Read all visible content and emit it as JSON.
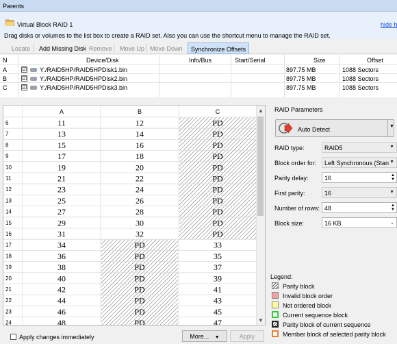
{
  "window": {
    "title": "Parents"
  },
  "panel": {
    "raid_name": "Virtual Block RAID 1",
    "hide_link": "hide hi",
    "instructions": "Drag disks or volumes to the list box to create a RAID set. Also you can use the shortcut menu to manage the RAID set."
  },
  "toolbar": {
    "locate": "Locate",
    "add_missing": "Add Missing Disk",
    "remove": "Remove",
    "move_up": "Move Up",
    "move_down": "Move Down",
    "sync_offsets": "Synchronize Offsets"
  },
  "disk_table": {
    "headers": {
      "n": "N",
      "device": "Device/Disk",
      "info": "Info/Bus",
      "start": "Start/Serial",
      "size": "Size",
      "offset": "Offset"
    },
    "rows": [
      {
        "n": "A",
        "checked": "☑",
        "device": "Y:/RAID5HP/RAID5HPDisk1.bin",
        "size": "897.75 MB",
        "offset": "1088 Sectors"
      },
      {
        "n": "B",
        "checked": "☑",
        "device": "Y:/RAID5HP/RAID5HPDisk2.bin",
        "size": "897.75 MB",
        "offset": "1088 Sectors"
      },
      {
        "n": "C",
        "checked": "☑",
        "device": "Y:/RAID5HP/RAID5HPDisk3.bin",
        "size": "897.75 MB",
        "offset": "1088 Sectors"
      }
    ]
  },
  "block_grid": {
    "columns": [
      "A",
      "B",
      "C"
    ],
    "rows": [
      {
        "n": "6",
        "cells": [
          "11",
          "12",
          "PD"
        ]
      },
      {
        "n": "7",
        "cells": [
          "13",
          "14",
          "PD"
        ]
      },
      {
        "n": "8",
        "cells": [
          "15",
          "16",
          "PD"
        ]
      },
      {
        "n": "9",
        "cells": [
          "17",
          "18",
          "PD"
        ]
      },
      {
        "n": "10",
        "cells": [
          "19",
          "20",
          "PD"
        ]
      },
      {
        "n": "11",
        "cells": [
          "21",
          "22",
          "PD"
        ]
      },
      {
        "n": "12",
        "cells": [
          "23",
          "24",
          "PD"
        ]
      },
      {
        "n": "13",
        "cells": [
          "25",
          "26",
          "PD"
        ]
      },
      {
        "n": "14",
        "cells": [
          "27",
          "28",
          "PD"
        ]
      },
      {
        "n": "15",
        "cells": [
          "29",
          "30",
          "PD"
        ]
      },
      {
        "n": "16",
        "cells": [
          "31",
          "32",
          "PD"
        ]
      },
      {
        "n": "17",
        "cells": [
          "34",
          "PD",
          "33"
        ]
      },
      {
        "n": "18",
        "cells": [
          "36",
          "PD",
          "35"
        ]
      },
      {
        "n": "19",
        "cells": [
          "38",
          "PD",
          "37"
        ]
      },
      {
        "n": "20",
        "cells": [
          "40",
          "PD",
          "39"
        ]
      },
      {
        "n": "21",
        "cells": [
          "42",
          "PD",
          "41"
        ]
      },
      {
        "n": "22",
        "cells": [
          "44",
          "PD",
          "43"
        ]
      },
      {
        "n": "23",
        "cells": [
          "46",
          "PD",
          "45"
        ]
      },
      {
        "n": "24",
        "cells": [
          "48",
          "PD",
          "47"
        ]
      }
    ]
  },
  "bottom": {
    "apply_immediately": "Apply changes immediately",
    "more": "More...",
    "apply": "Apply"
  },
  "raid_params": {
    "title": "RAID Parameters",
    "auto_detect": "Auto Detect",
    "raid_type_label": "RAID type:",
    "raid_type": "RAID5",
    "block_order_label": "Block order for:",
    "block_order": "Left Synchronous (Stan",
    "parity_delay_label": "Parity delay:",
    "parity_delay": "16",
    "first_parity_label": "First parity:",
    "first_parity": "16",
    "rows_label": "Number of rows:",
    "rows": "48",
    "block_size_label": "Block size:",
    "block_size": "16 KB"
  },
  "legend": {
    "title": "Legend:",
    "items": [
      {
        "label": "Parity block",
        "color": "#ffffff"
      },
      {
        "label": "Invalid block order",
        "color": "#f4a0a0"
      },
      {
        "label": "Not ordered block",
        "color": "#ffff99"
      },
      {
        "label": "Current sequence block",
        "color": "#33cc33"
      },
      {
        "label": "Parity block of current sequence",
        "color": "#ffffff"
      },
      {
        "label": "Member block of selected parity block",
        "color": "#f07a30"
      }
    ]
  }
}
